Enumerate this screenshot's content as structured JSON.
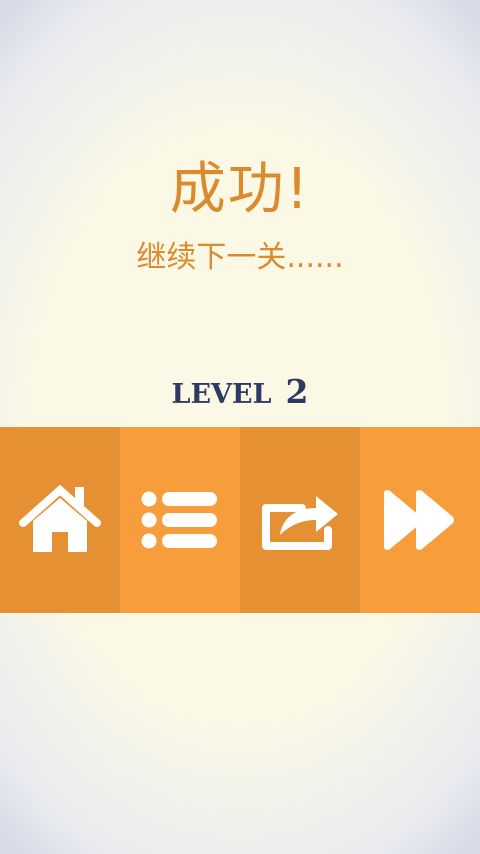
{
  "screen": {
    "title": "成功!",
    "subtitle": "继续下一关......",
    "level_label": "LEVEL",
    "level_number": "2"
  },
  "toolbar": {
    "buttons": [
      {
        "icon": "home-icon",
        "color": "#e49033"
      },
      {
        "icon": "list-icon",
        "color": "#f89d3b"
      },
      {
        "icon": "share-icon",
        "color": "#e49033"
      },
      {
        "icon": "fast-forward-icon",
        "color": "#f89d3b"
      }
    ]
  },
  "colors": {
    "accent": "#db8b2e",
    "level_text": "#2f3a62",
    "background": "#fbf8e6",
    "icon": "#ffffff"
  }
}
